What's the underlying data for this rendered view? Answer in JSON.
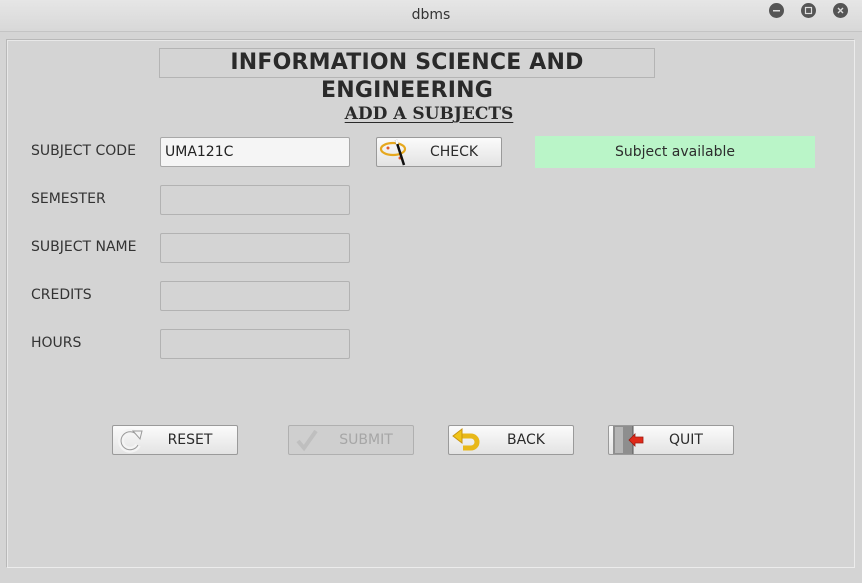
{
  "window": {
    "title": "dbms",
    "controls": [
      "minimize",
      "maximize",
      "close"
    ]
  },
  "header": {
    "department": "INFORMATION SCIENCE AND ENGINEERING",
    "form_title": "ADD A SUBJECTS"
  },
  "form": {
    "subject_code": {
      "label": "SUBJECT CODE",
      "value": "UMA121C"
    },
    "semester": {
      "label": "SEMESTER",
      "value": ""
    },
    "subject_name": {
      "label": "SUBJECT NAME",
      "value": ""
    },
    "credits": {
      "label": "CREDITS",
      "value": ""
    },
    "hours": {
      "label": "HOURS",
      "value": ""
    }
  },
  "check_button": {
    "label": "CHECK",
    "icon": "magic-wand-icon"
  },
  "status": {
    "text": "Subject available",
    "color": "#baf5c8"
  },
  "actions": {
    "reset": {
      "label": "RESET",
      "icon": "refresh-icon"
    },
    "submit": {
      "label": "SUBMIT",
      "icon": "checkmark-icon",
      "enabled": false
    },
    "back": {
      "label": "BACK",
      "icon": "undo-arrow-icon"
    },
    "quit": {
      "label": "QUIT",
      "icon": "exit-door-icon"
    }
  }
}
